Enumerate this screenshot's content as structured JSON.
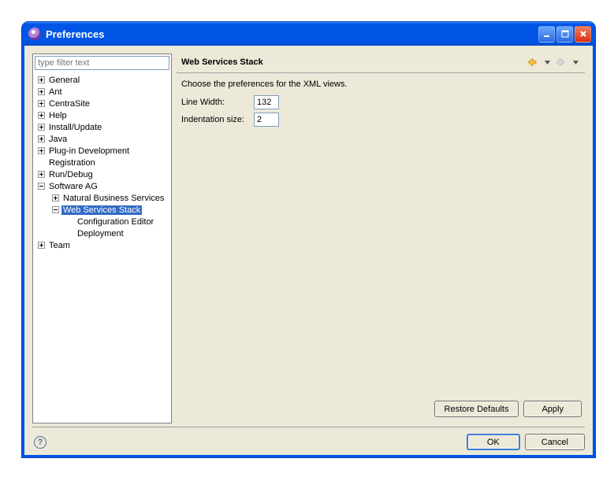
{
  "window": {
    "title": "Preferences"
  },
  "filter": {
    "placeholder": "type filter text"
  },
  "tree": {
    "general": "General",
    "ant": "Ant",
    "centrasite": "CentraSite",
    "help": "Help",
    "install_update": "Install/Update",
    "java": "Java",
    "plugin_dev": "Plug-in Development",
    "registration": "Registration",
    "run_debug": "Run/Debug",
    "software_ag": "Software AG",
    "nbs": "Natural Business Services",
    "wss": "Web Services Stack",
    "config_editor": "Configuration Editor",
    "deployment": "Deployment",
    "team": "Team"
  },
  "page": {
    "title": "Web Services Stack",
    "description": "Choose the preferences for the XML views.",
    "line_width_label": "Line Width:",
    "line_width_value": "132",
    "indentation_label": "Indentation size:",
    "indentation_value": "2"
  },
  "buttons": {
    "restore_defaults": "Restore Defaults",
    "apply": "Apply",
    "ok": "OK",
    "cancel": "Cancel"
  }
}
